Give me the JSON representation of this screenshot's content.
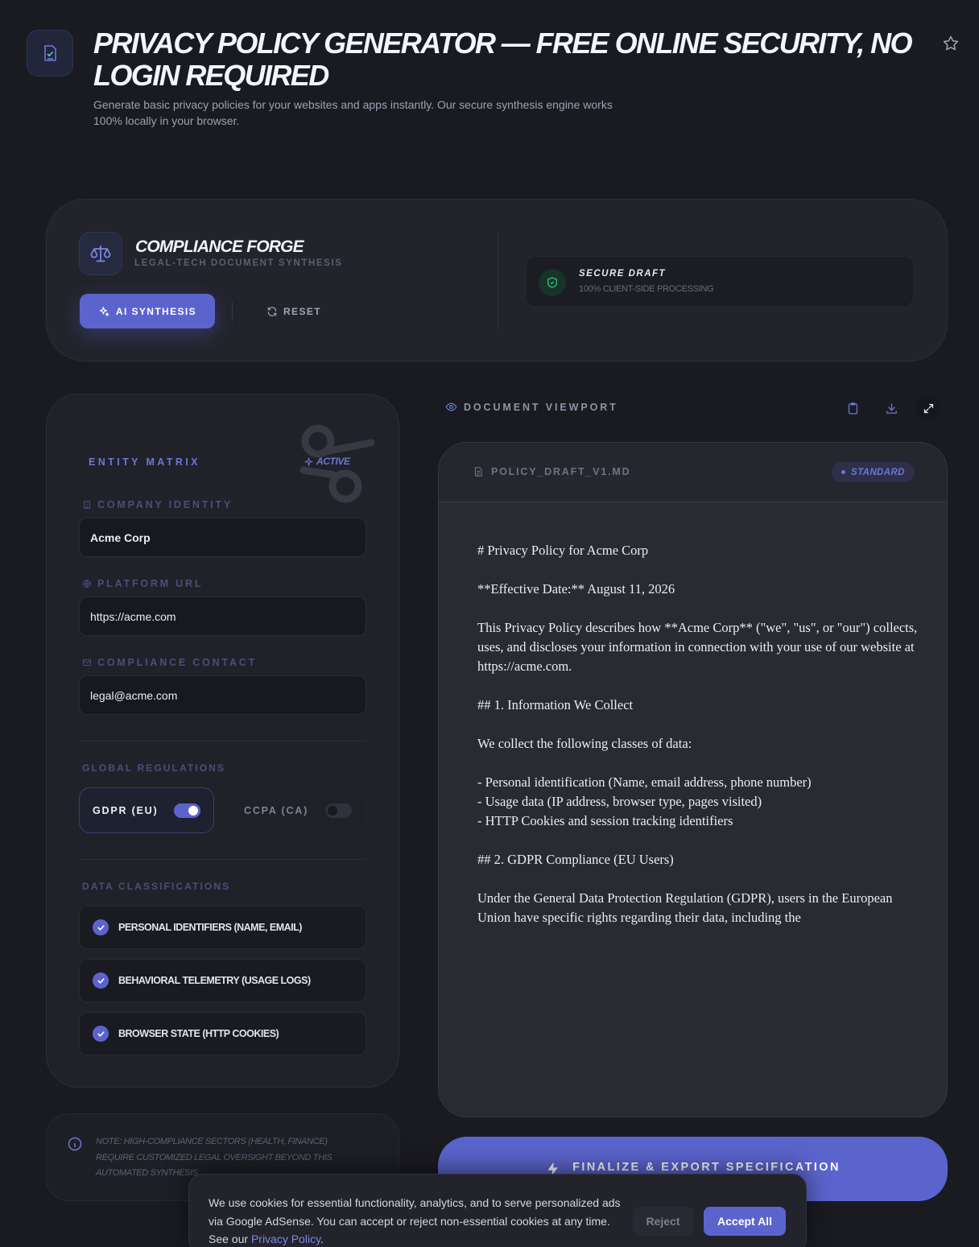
{
  "header": {
    "title": "PRIVACY POLICY GENERATOR — FREE ONLINE SECURITY, NO LOGIN REQUIRED",
    "subtitle": "Generate basic privacy policies for your websites and apps instantly. Our secure synthesis engine works 100% locally in your browser.",
    "icons": {
      "logo": "document-check-icon",
      "favorite": "star-icon"
    }
  },
  "toolbar": {
    "brand_name": "COMPLIANCE FORGE",
    "brand_tagline": "LEGAL-TECH DOCUMENT SYNTHESIS",
    "ai_button": "AI SYNTHESIS",
    "reset_button": "RESET",
    "secure_title": "SECURE DRAFT",
    "secure_subtitle": "100% CLIENT-SIDE PROCESSING",
    "icons": {
      "brand": "scales-icon",
      "ai": "sparkles-icon",
      "reset": "refresh-icon",
      "secure": "shield-check-icon"
    }
  },
  "entity_matrix": {
    "title": "ENTITY MATRIX",
    "status": "ACTIVE",
    "fields": {
      "company": {
        "label": "COMPANY IDENTITY",
        "value": "Acme Corp",
        "icon": "building-icon"
      },
      "url": {
        "label": "PLATFORM URL",
        "value": "https://acme.com",
        "icon": "globe-icon"
      },
      "contact": {
        "label": "COMPLIANCE CONTACT",
        "value": "legal@acme.com",
        "icon": "mail-icon"
      }
    },
    "regulations": {
      "label": "GLOBAL REGULATIONS",
      "gdpr": {
        "label": "GDPR (EU)",
        "enabled": true
      },
      "ccpa": {
        "label": "CCPA (CA)",
        "enabled": false
      }
    },
    "classifications": {
      "label": "DATA CLASSIFICATIONS",
      "items": [
        {
          "label": "PERSONAL IDENTIFIERS (NAME, EMAIL)",
          "checked": true
        },
        {
          "label": "BEHAVIORAL TELEMETRY (USAGE LOGS)",
          "checked": true
        },
        {
          "label": "BROWSER STATE (HTTP COOKIES)",
          "checked": true
        }
      ]
    }
  },
  "note": {
    "text": "NOTE: HIGH-COMPLIANCE SECTORS (HEALTH, FINANCE) REQUIRE CUSTOMIZED LEGAL OVERSIGHT BEYOND THIS AUTOMATED SYNTHESIS",
    "icon": "info-icon"
  },
  "viewport": {
    "label": "DOCUMENT VIEWPORT",
    "icons": {
      "eye": "eye-icon",
      "copy": "clipboard-icon",
      "download": "download-icon",
      "expand": "expand-icon"
    },
    "filename": "POLICY_DRAFT_V1.MD",
    "badge": "STANDARD",
    "document_text": "# Privacy Policy for Acme Corp\n\n**Effective Date:** August 11, 2026\n\nThis Privacy Policy describes how **Acme Corp** (\"we\", \"us\", or \"our\") collects, uses, and discloses your information in connection with your use of our website at https://acme.com.\n\n## 1. Information We Collect\n\nWe collect the following classes of data:\n\n- Personal identification (Name, email address, phone number)\n- Usage data (IP address, browser type, pages visited)\n- HTTP Cookies and session tracking identifiers\n\n## 2. GDPR Compliance (EU Users)\n\nUnder the General Data Protection Regulation (GDPR), users in the European Union have specific rights regarding their data, including the"
  },
  "finalize_button": "FINALIZE & EXPORT SPECIFICATION",
  "cookie_banner": {
    "text": "We use cookies for essential functionality, analytics, and to serve personalized ads via Google AdSense. You can accept or reject non-essential cookies at any time. See our ",
    "link": "Privacy Policy",
    "text_end": ".",
    "reject": "Reject",
    "accept": "Accept All"
  },
  "colors": {
    "accent": "#5b64cd",
    "background": "#1a1b21",
    "success": "#2fbf80"
  }
}
